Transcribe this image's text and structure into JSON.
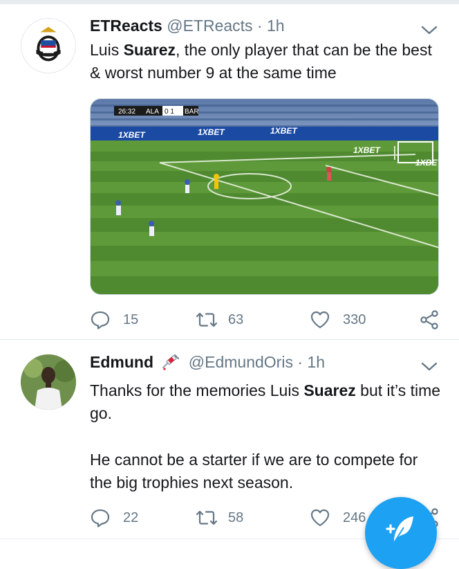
{
  "tweets": [
    {
      "name": "ETReacts",
      "handle": "@ETReacts",
      "dot": " · ",
      "time": "1h",
      "text_parts": [
        "Luis ",
        "Suarez",
        ", the only player that can be the best & worst number 9 at the same time"
      ],
      "media": {
        "scoreboard_time": "26:32",
        "home": "ALA",
        "score": "0 1",
        "away": "BAR",
        "ad_text": "1XBET"
      },
      "replies": "15",
      "retweets": "63",
      "likes": "330"
    },
    {
      "name": "Edmund",
      "handle": "@EdmundOris",
      "dot": " · ",
      "time": "1h",
      "text_parts": [
        "Thanks for the memories Luis ",
        "Suarez",
        " but it’s time go."
      ],
      "text2": "He cannot be a starter if we are to compete for the big trophies next season.",
      "replies": "22",
      "retweets": "58",
      "likes": "246"
    }
  ],
  "colors": {
    "accent": "#1da1f2",
    "secondary_text": "#657786",
    "divider": "#e6ecf0",
    "pitch_light": "#5f9a3a",
    "pitch_dark": "#4f8a30"
  },
  "icons": {
    "reply": "reply-icon",
    "retweet": "retweet-icon",
    "like": "heart-icon",
    "share": "share-icon",
    "caret": "chevron-down-icon",
    "compose": "compose-tweet-icon",
    "name_emoji": "syringe-emoji"
  }
}
